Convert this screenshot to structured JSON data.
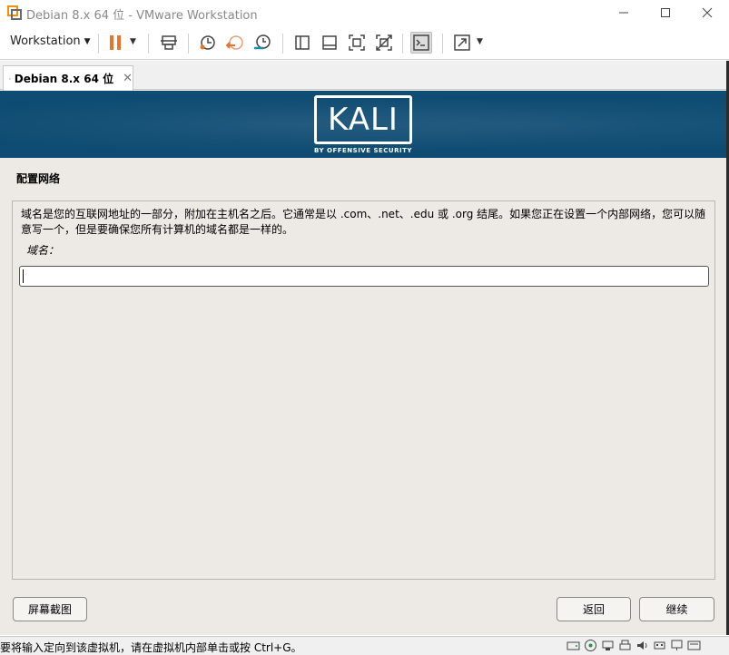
{
  "window": {
    "title": "Debian 8.x 64 位 - VMware Workstation",
    "controls": [
      "minimize",
      "maximize",
      "close"
    ]
  },
  "toolbar": {
    "workstation_menu": "Workstation",
    "icons": [
      "pause-icon",
      "send-ctrl-alt-del-icon",
      "snapshot-icon",
      "revert-snapshot-icon",
      "snapshot-manager-icon",
      "view-sidebar-icon",
      "view-thumbnail-icon",
      "fullscreen-icon",
      "unity-icon",
      "console-icon",
      "stretch-icon"
    ]
  },
  "tabs": [
    {
      "label": "Debian 8.x 64 位",
      "active": true
    }
  ],
  "installer": {
    "brand": "KALI",
    "brand_sub": "BY OFFENSIVE SECURITY",
    "section_title": "配置网络",
    "description": "域名是您的互联网地址的一部分，附加在主机名之后。它通常是以 .com、.net、.edu 或 .org 结尾。如果您正在设置一个内部网络，您可以随意写一个，但是要确保您所有计算机的域名都是一样的。",
    "field_label": "域名：",
    "field_value": "",
    "screenshot_button": "屏幕截图",
    "back_button": "返回",
    "continue_button": "继续"
  },
  "status": {
    "message": "要将输入定向到该虚拟机，请在虚拟机内部单击或按 Ctrl+G。"
  },
  "colors": {
    "banner": "#0f4c73",
    "vm_background": "#ede9e4",
    "pause_orange": "#e8742b"
  }
}
